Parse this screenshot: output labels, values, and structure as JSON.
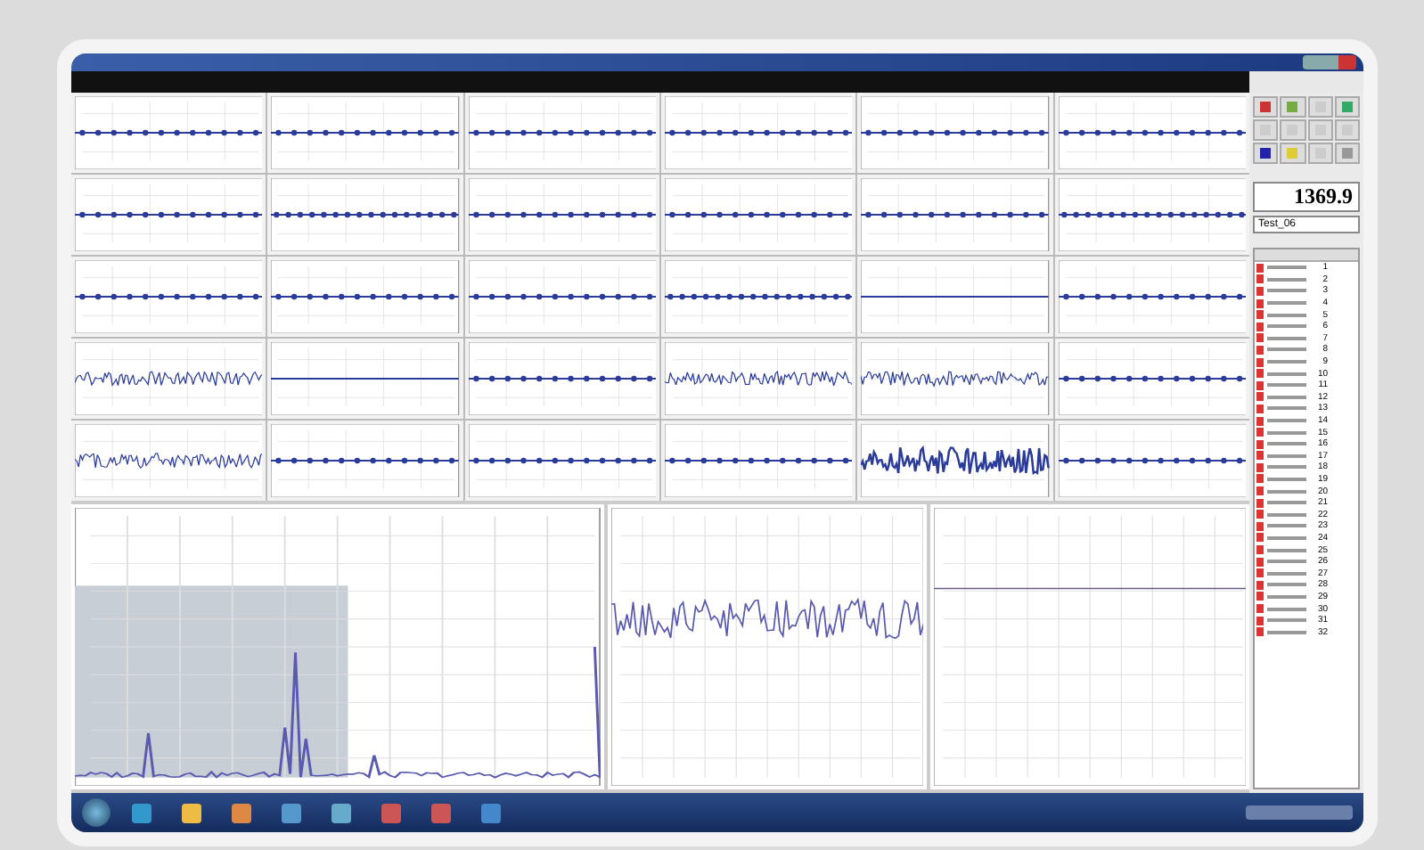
{
  "plots": [
    {
      "kind": "dots"
    },
    {
      "kind": "dots"
    },
    {
      "kind": "dots"
    },
    {
      "kind": "dots"
    },
    {
      "kind": "dots"
    },
    {
      "kind": "dots"
    },
    {
      "kind": "dots"
    },
    {
      "kind": "dense"
    },
    {
      "kind": "dots"
    },
    {
      "kind": "dots"
    },
    {
      "kind": "dots"
    },
    {
      "kind": "dense"
    },
    {
      "kind": "dots"
    },
    {
      "kind": "dots"
    },
    {
      "kind": "dots"
    },
    {
      "kind": "dense"
    },
    {
      "kind": "flat"
    },
    {
      "kind": "dots"
    },
    {
      "kind": "noise"
    },
    {
      "kind": "flat"
    },
    {
      "kind": "dots"
    },
    {
      "kind": "noise"
    },
    {
      "kind": "noise"
    },
    {
      "kind": "dots"
    },
    {
      "kind": "noise"
    },
    {
      "kind": "dots"
    },
    {
      "kind": "dots"
    },
    {
      "kind": "dots"
    },
    {
      "kind": "burst"
    },
    {
      "kind": "dots"
    }
  ],
  "large_plots": [
    {
      "kind": "spectrum"
    },
    {
      "kind": "wave"
    },
    {
      "kind": "flat"
    }
  ],
  "readout": "1369.9",
  "test_select": {
    "value": "Test_06"
  },
  "channel_list": [
    {
      "number": "1"
    },
    {
      "number": "2"
    },
    {
      "number": "3"
    },
    {
      "number": "4"
    },
    {
      "number": "5"
    },
    {
      "number": "6"
    },
    {
      "number": "7"
    },
    {
      "number": "8"
    },
    {
      "number": "9"
    },
    {
      "number": "10"
    },
    {
      "number": "11"
    },
    {
      "number": "12"
    },
    {
      "number": "13"
    },
    {
      "number": "14"
    },
    {
      "number": "15"
    },
    {
      "number": "16"
    },
    {
      "number": "17"
    },
    {
      "number": "18"
    },
    {
      "number": "19"
    },
    {
      "number": "20"
    },
    {
      "number": "21"
    },
    {
      "number": "22"
    },
    {
      "number": "23"
    },
    {
      "number": "24"
    },
    {
      "number": "25"
    },
    {
      "number": "26"
    },
    {
      "number": "27"
    },
    {
      "number": "28"
    },
    {
      "number": "29"
    },
    {
      "number": "30"
    },
    {
      "number": "31"
    },
    {
      "number": "32"
    }
  ]
}
